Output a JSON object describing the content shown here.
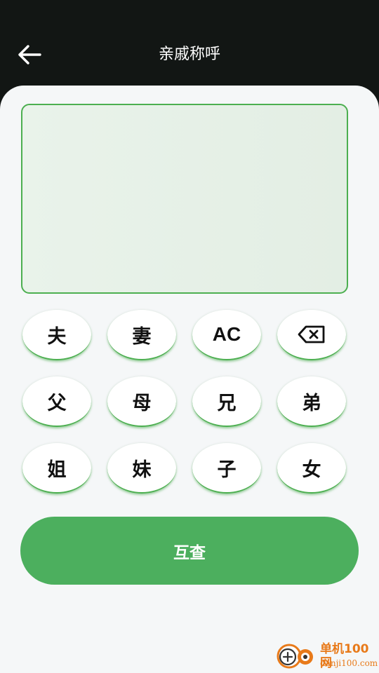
{
  "header": {
    "title": "亲戚称呼",
    "back_icon": "arrow-left-icon"
  },
  "display": {
    "text": ""
  },
  "keypad": {
    "rows": [
      [
        "夫",
        "妻",
        "AC",
        "backspace"
      ],
      [
        "父",
        "母",
        "兄",
        "弟"
      ],
      [
        "姐",
        "妹",
        "子",
        "女"
      ]
    ],
    "keys": {
      "husband": "夫",
      "wife": "妻",
      "clear": "AC",
      "backspace_icon": "backspace-icon",
      "father": "父",
      "mother": "母",
      "elder_brother": "兄",
      "younger_brother": "弟",
      "elder_sister": "姐",
      "younger_sister": "妹",
      "son": "子",
      "daughter": "女"
    }
  },
  "actions": {
    "search_label": "互查"
  },
  "watermark": {
    "name": "单机100网",
    "url": "danji100.com"
  },
  "colors": {
    "header_bg": "#121614",
    "panel_bg": "#f5f7f8",
    "accent": "#4caf50",
    "display_bg": "#e6f0e7",
    "button_text": "#111111",
    "watermark": "#e87a1a"
  }
}
